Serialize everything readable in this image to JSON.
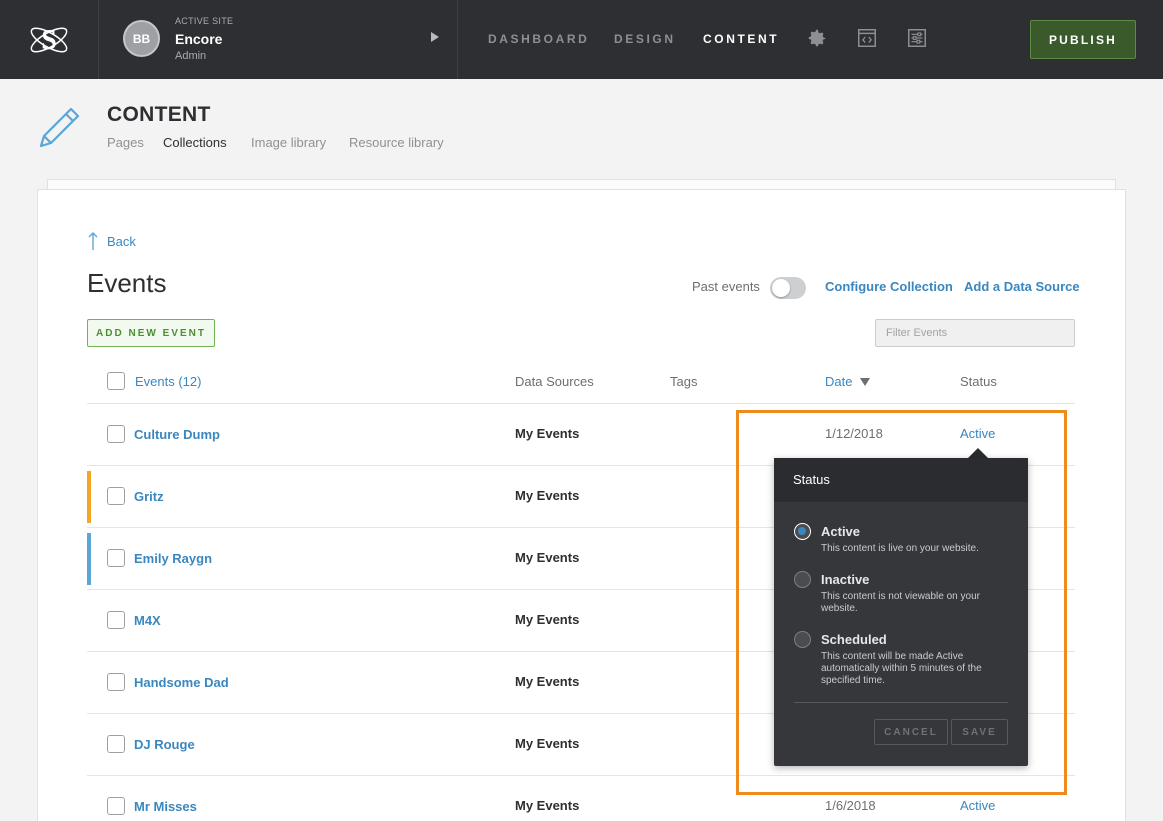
{
  "topbar": {
    "active_site_label": "ACTIVE SITE",
    "site_name": "Encore",
    "site_role": "Admin",
    "avatar_initials": "BB",
    "nav": [
      "DASHBOARD",
      "DESIGN",
      "CONTENT"
    ],
    "active_nav": "CONTENT",
    "icons": [
      "gear-icon",
      "code-window-icon",
      "sliders-icon"
    ],
    "publish_label": "PUBLISH"
  },
  "header": {
    "title": "CONTENT",
    "tabs": [
      "Pages",
      "Collections",
      "Image library",
      "Resource library"
    ],
    "active_tab": "Collections"
  },
  "collection": {
    "back_label": "Back",
    "title": "Events",
    "past_events_label": "Past events",
    "past_events_on": false,
    "configure_label": "Configure Collection",
    "add_source_label": "Add a Data Source",
    "add_button_label": "ADD NEW EVENT",
    "filter_placeholder": "Filter Events"
  },
  "table": {
    "headers": {
      "name": "Events (12)",
      "sources": "Data Sources",
      "tags": "Tags",
      "date": "Date",
      "status": "Status"
    },
    "rows": [
      {
        "name": "Culture Dump",
        "source": "My Events",
        "date": "1/12/2018",
        "status": "Active",
        "stripe": ""
      },
      {
        "name": "Gritz",
        "source": "My Events",
        "date": "",
        "status": "",
        "stripe": "#f5a623"
      },
      {
        "name": "Emily Raygn",
        "source": "My Events",
        "date": "",
        "status": "",
        "stripe": "#5aa6d6"
      },
      {
        "name": "M4X",
        "source": "My Events",
        "date": "",
        "status": "",
        "stripe": ""
      },
      {
        "name": "Handsome Dad",
        "source": "My Events",
        "date": "",
        "status": "",
        "stripe": ""
      },
      {
        "name": "DJ Rouge",
        "source": "My Events",
        "date": "",
        "status": "",
        "stripe": ""
      },
      {
        "name": "Mr Misses",
        "source": "My Events",
        "date": "1/6/2018",
        "status": "Active",
        "stripe": ""
      }
    ]
  },
  "popover": {
    "title": "Status",
    "options": [
      {
        "label": "Active",
        "desc": "This content is live on your website.",
        "selected": true
      },
      {
        "label": "Inactive",
        "desc": "This content is not viewable on your website.",
        "selected": false
      },
      {
        "label": "Scheduled",
        "desc": "This content will be made Active automatically within 5 minutes of the specified time.",
        "selected": false
      }
    ],
    "cancel_label": "CANCEL",
    "save_label": "SAVE"
  },
  "colors": {
    "topbar": "#2d2f33",
    "accent_blue": "#3a87c0",
    "publish_green": "#3b5a2c",
    "highlight_orange": "#ef8b1c"
  }
}
